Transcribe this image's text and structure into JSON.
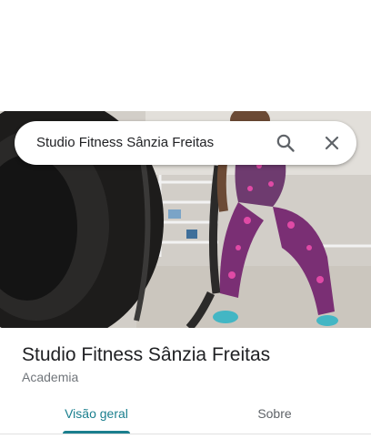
{
  "search": {
    "query": "Studio Fitness Sânzia Freitas"
  },
  "place": {
    "name": "Studio Fitness Sânzia Freitas",
    "category": "Academia"
  },
  "tabs": [
    {
      "label": "Visão geral",
      "active": true
    },
    {
      "label": "Sobre",
      "active": false
    }
  ],
  "colors": {
    "accent": "#1a7f8e",
    "text": "#202124",
    "secondary": "#70757a"
  }
}
